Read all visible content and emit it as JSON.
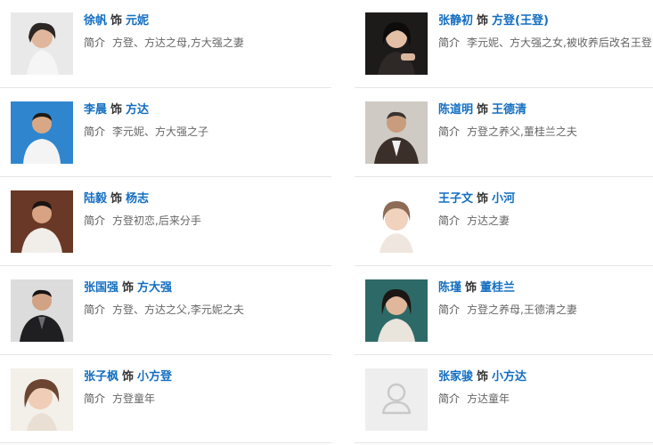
{
  "sep_word": "饰",
  "intro_label": "简介",
  "cast": [
    {
      "actor": "徐帆",
      "role": "元妮",
      "desc": "方登、方达之母,方大强之妻",
      "photo": "portrait-f1"
    },
    {
      "actor": "张静初",
      "role": "方登(王登)",
      "desc": "李元妮、方大强之女,被收养后改名王登",
      "photo": "portrait-f2"
    },
    {
      "actor": "李晨",
      "role": "方达",
      "desc": "李元妮、方大强之子",
      "photo": "portrait-m1"
    },
    {
      "actor": "陈道明",
      "role": "王德清",
      "desc": "方登之养父,董桂兰之夫",
      "photo": "portrait-m2"
    },
    {
      "actor": "陆毅",
      "role": "杨志",
      "desc": "方登初恋,后来分手",
      "photo": "portrait-m3"
    },
    {
      "actor": "王子文",
      "role": "小河",
      "desc": "方达之妻",
      "photo": "portrait-f3"
    },
    {
      "actor": "张国强",
      "role": "方大强",
      "desc": "方登、方达之父,李元妮之夫",
      "photo": "portrait-m4"
    },
    {
      "actor": "陈瑾",
      "role": "董桂兰",
      "desc": "方登之养母,王德清之妻",
      "photo": "portrait-f4"
    },
    {
      "actor": "张子枫",
      "role": "小方登",
      "desc": "方登童年",
      "photo": "portrait-f5"
    },
    {
      "actor": "张家骏",
      "role": "小方达",
      "desc": "方达童年",
      "photo": "placeholder-avatar-icon"
    }
  ]
}
